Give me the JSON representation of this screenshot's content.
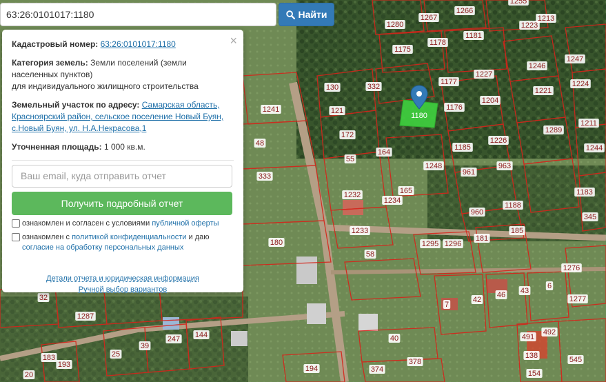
{
  "search": {
    "value": "63:26:0101017:1180",
    "button_label": "Найти"
  },
  "popup": {
    "close_glyph": "×",
    "cadastral_label": "Кадастровый номер:",
    "cadastral_value": "63:26:0101017:1180",
    "category_label": "Категория земель:",
    "category_value": "Земли поселений (земли населенных пунктов)",
    "category_use": "для индивидуального жилищного строительства",
    "address_label": "Земельный участок по адресу:",
    "address_value": "Самарская область, Красноярский район, сельское поселение Новый Буян, с.Новый Буян, ул. Н.А.Некрасова,1",
    "area_label": "Уточненная площадь:",
    "area_value": "1 000 кв.м.",
    "email_placeholder": "Ваш email, куда отправить отчет",
    "report_button": "Получить подробный отчет",
    "agree1_text": "ознакомлен и согласен с условиями",
    "agree1_link": "публичной оферты",
    "agree2_text": "ознакомлен с",
    "agree2_link": "политикой конфиденциальности",
    "agree2_mid": "и даю",
    "agree2_link2": "согласие на обработку персональных данных",
    "details_link": "Детали отчета и юридическая информация",
    "manual_link": "Ручной выбор вариантов"
  },
  "map": {
    "selected_label": "1180",
    "accent_color": "#337ab7",
    "selected_color": "#3fd23f",
    "parcel_labels": [
      "1255",
      "1266",
      "1267",
      "1213",
      "1280",
      "1223",
      "1181",
      "1178",
      "1175",
      "1247",
      "1246",
      "1227",
      "130",
      "332",
      "1177",
      "1221",
      "1224",
      "1204",
      "1176",
      "121",
      "1241",
      "1289",
      "1211",
      "172",
      "1226",
      "1185",
      "1244",
      "48",
      "55",
      "164",
      "1248",
      "961",
      "963",
      "333",
      "1232",
      "165",
      "1183",
      "1234",
      "1188",
      "960",
      "345",
      "1233",
      "185",
      "181",
      "1295",
      "1296",
      "180",
      "58",
      "1276",
      "42",
      "46",
      "43",
      "6",
      "1277",
      "7",
      "32",
      "1287",
      "40",
      "247",
      "144",
      "25",
      "39",
      "491",
      "492",
      "138",
      "545",
      "183",
      "193",
      "194",
      "374",
      "378",
      "20",
      "154"
    ]
  }
}
